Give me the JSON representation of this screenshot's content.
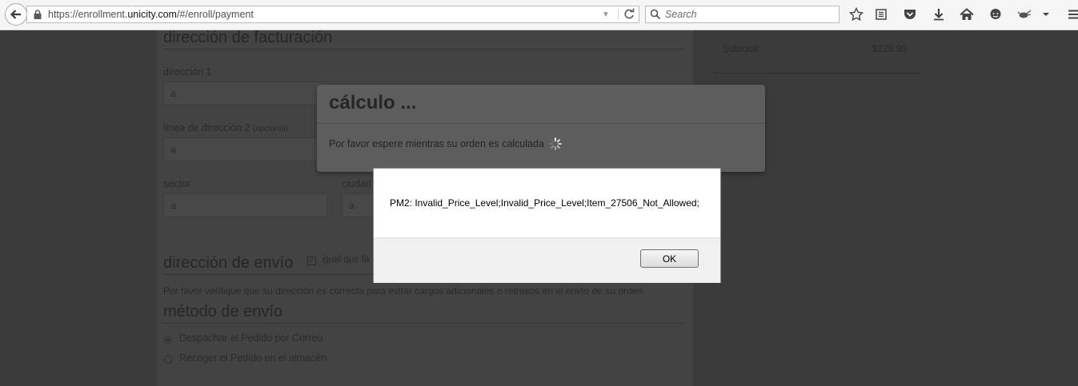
{
  "browser": {
    "url_prefix": "https://enrollment.",
    "url_domain": "unicity.com",
    "url_path": "/#/enroll/payment",
    "search_placeholder": "Search"
  },
  "page": {
    "billing_title": "dirección de facturación",
    "address1_label": "dirección 1",
    "address1_value": "a",
    "address2_label": "línea de dirección 2",
    "address2_optional": "(opcional)",
    "address2_value": "a",
    "sector_label": "sector",
    "sector_value": "a",
    "city_label": "ciudad",
    "city_value": "a",
    "shipping_title": "dirección de envío",
    "same_as_billing": "igual que fa",
    "shipping_note": "Por favor verifique que su dirección es correcta para evitar cargos adicionales o retrasos en el envío de su orden.",
    "method_title": "método de envío",
    "option_mail": "Despachar el Pedido por Correo",
    "option_pickup": "Recoger el Pedido en el almacén",
    "subtotal_label": "Subtotal:",
    "subtotal_value": "$129.90"
  },
  "calc_modal": {
    "title": "cálculo ...",
    "message": "Por favor espere mientras su orden es calculada"
  },
  "alert": {
    "message": "PM2: Invalid_Price_Level;Invalid_Price_Level;Item_27506_Not_Allowed;",
    "ok_label": "OK"
  }
}
